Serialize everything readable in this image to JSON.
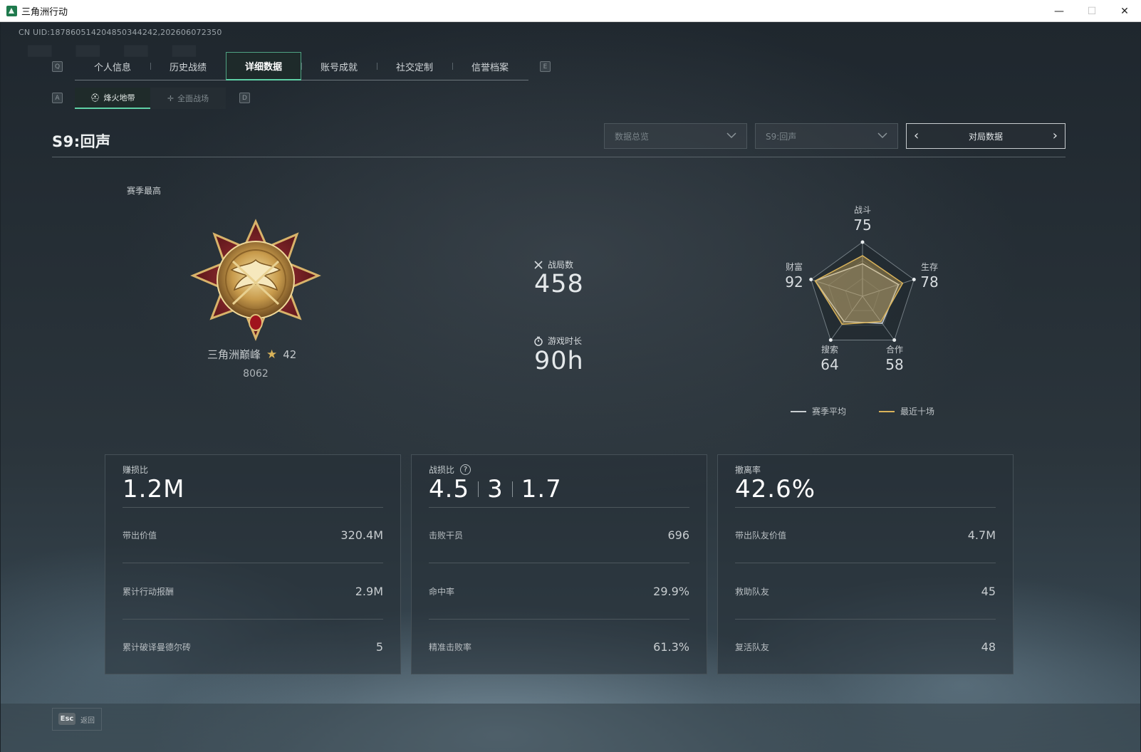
{
  "window": {
    "title": "三角洲行动",
    "minimize": "—",
    "maximize": "☐",
    "close": "✕"
  },
  "uid_text": "CN UID:187860514204850344242,202606072350",
  "tabs": {
    "left_key": "Q",
    "right_key": "E",
    "items": [
      {
        "label": "个人信息",
        "active": false
      },
      {
        "label": "历史战绩",
        "active": false
      },
      {
        "label": "详细数据",
        "active": true
      },
      {
        "label": "账号成就",
        "active": false
      },
      {
        "label": "社交定制",
        "active": false
      },
      {
        "label": "信誉档案",
        "active": false
      }
    ]
  },
  "subtabs": {
    "left_key": "A",
    "right_key": "D",
    "items": [
      {
        "label": "烽火地带",
        "icon": "helmet-icon",
        "active": true
      },
      {
        "label": "全面战场",
        "icon": "crosshair-icon",
        "active": false
      }
    ]
  },
  "season": {
    "title": "S9:回声",
    "dropdown_1": "数据总览",
    "dropdown_2": "S9:回声",
    "pager_label": "对局数据",
    "pager_prev": "‹",
    "pager_next": "›"
  },
  "rank": {
    "season_best_label": "赛季最高",
    "name": "三角洲巅峰",
    "stars": "42",
    "score": "8062"
  },
  "overview": {
    "matches_label": "战局数",
    "matches_value": "458",
    "playtime_label": "游戏时长",
    "playtime_value": "90h"
  },
  "radar": {
    "axes": [
      {
        "name": "战斗",
        "value": "75"
      },
      {
        "name": "生存",
        "value": "78"
      },
      {
        "name": "合作",
        "value": "58"
      },
      {
        "name": "搜索",
        "value": "64"
      },
      {
        "name": "财富",
        "value": "92"
      }
    ],
    "season_avg": [
      60,
      70,
      62,
      58,
      92
    ],
    "recent": [
      75,
      78,
      58,
      64,
      92
    ],
    "legend_avg": "赛季平均",
    "legend_recent": "最近十场",
    "color_avg": "#c9ced2",
    "color_recent": "#d9b35a"
  },
  "cards": [
    {
      "label": "赚损比",
      "big": "1.2M",
      "rows": [
        {
          "k": "带出价值",
          "v": "320.4M"
        },
        {
          "k": "累计行动报酬",
          "v": "2.9M"
        },
        {
          "k": "累计破译曼德尔砖",
          "v": "5"
        }
      ]
    },
    {
      "label": "战损比",
      "big_parts": [
        "4.5",
        "3",
        "1.7"
      ],
      "rows": [
        {
          "k": "击败干员",
          "v": "696"
        },
        {
          "k": "命中率",
          "v": "29.9%"
        },
        {
          "k": "精准击败率",
          "v": "61.3%"
        }
      ]
    },
    {
      "label": "撤离率",
      "big": "42.6%",
      "rows": [
        {
          "k": "带出队友价值",
          "v": "4.7M"
        },
        {
          "k": "救助队友",
          "v": "45"
        },
        {
          "k": "复活队友",
          "v": "48"
        }
      ]
    }
  ],
  "footer": {
    "esc_key": "Esc",
    "back_label": "返回"
  }
}
